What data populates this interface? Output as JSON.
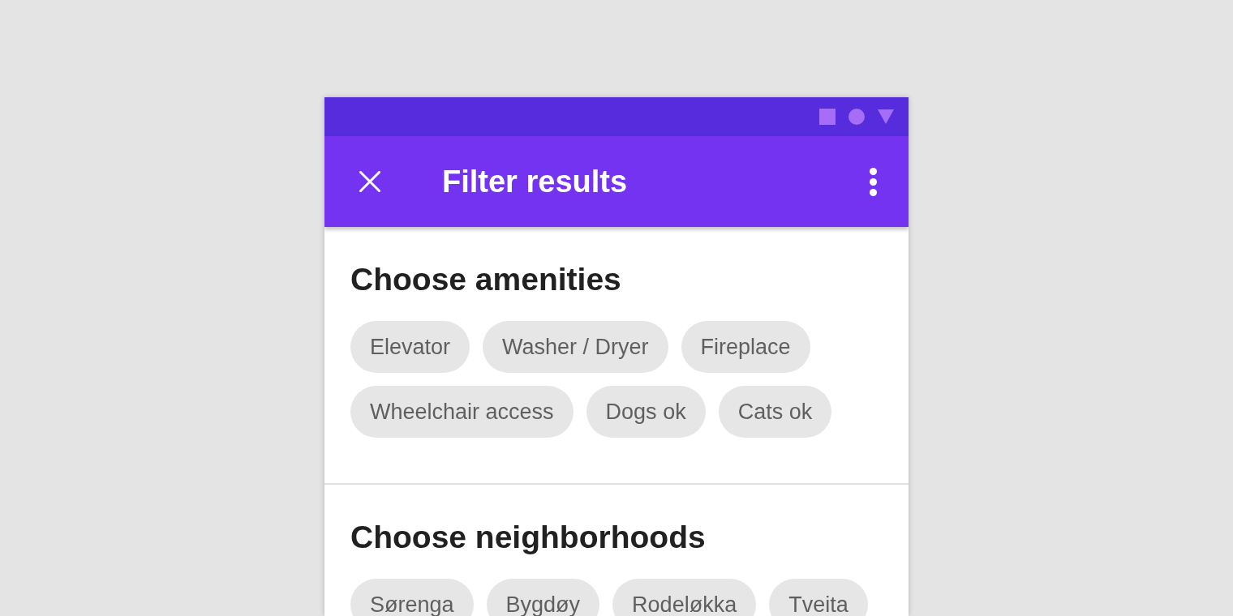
{
  "app_bar": {
    "title": "Filter results"
  },
  "sections": [
    {
      "heading": "Choose amenities",
      "chips": [
        {
          "label": "Elevator",
          "selected": false
        },
        {
          "label": "Washer / Dryer",
          "selected": false
        },
        {
          "label": "Fireplace",
          "selected": false
        },
        {
          "label": "Wheelchair access",
          "selected": false
        },
        {
          "label": "Dogs ok",
          "selected": false
        },
        {
          "label": "Cats ok",
          "selected": false
        }
      ]
    },
    {
      "heading": "Choose neighborhoods",
      "chips": [
        {
          "label": "Sørenga",
          "selected": false
        },
        {
          "label": "Bygdøy",
          "selected": false
        },
        {
          "label": "Rodeløkka",
          "selected": false
        },
        {
          "label": "Tveita",
          "selected": false
        }
      ]
    }
  ]
}
